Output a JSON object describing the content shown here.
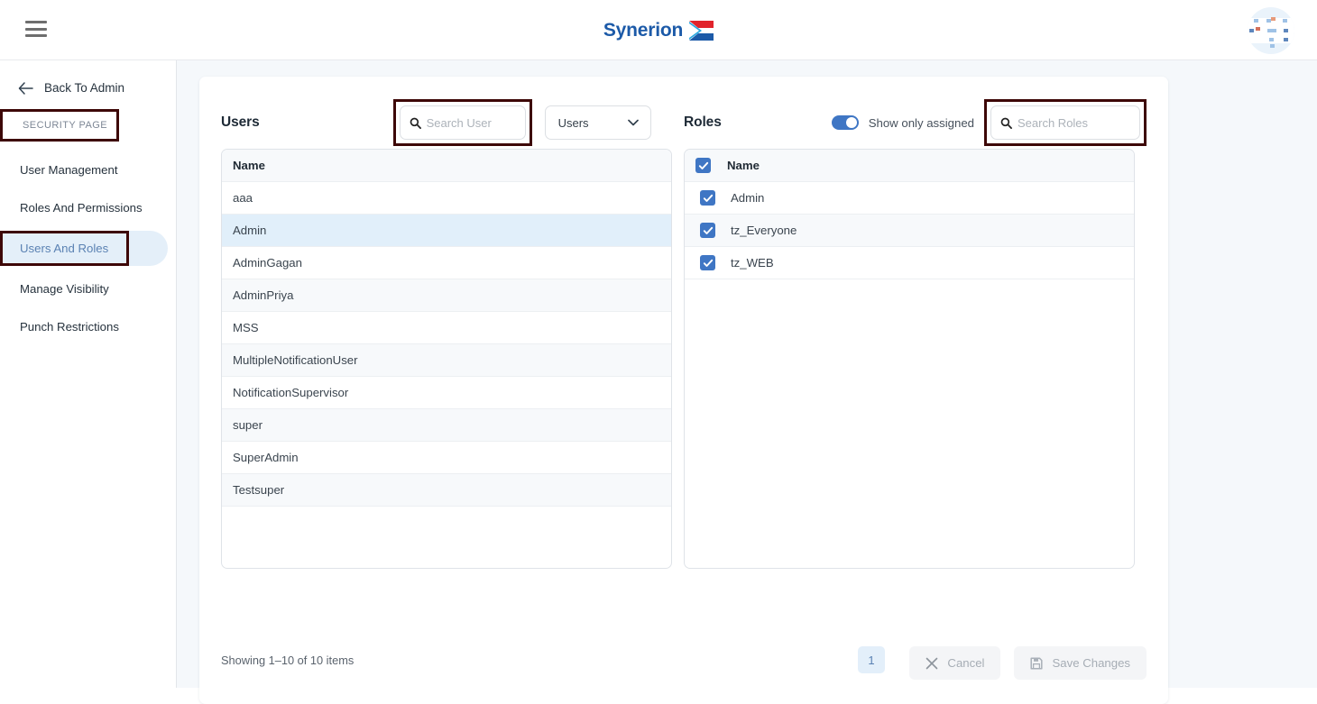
{
  "topbar": {
    "menu_icon": "hamburger-icon",
    "brand_name": "Synerion",
    "avatar_icon": "user-avatar"
  },
  "sidebar": {
    "back_label": "Back To Admin",
    "back_icon": "arrow-left-icon",
    "section_label": "SECURITY PAGE",
    "items": [
      {
        "label": "User Management",
        "active": false
      },
      {
        "label": "Roles And Permissions",
        "active": false
      },
      {
        "label": "Users And Roles",
        "active": true
      },
      {
        "label": "Manage Visibility",
        "active": false
      },
      {
        "label": "Punch Restrictions",
        "active": false
      }
    ]
  },
  "users_panel": {
    "title": "Users",
    "search": {
      "placeholder": "Search User",
      "value": "",
      "icon": "search-icon"
    },
    "filter_select": {
      "value": "Users",
      "icon": "chevron-down-icon"
    },
    "column_header": "Name",
    "rows": [
      {
        "name": "aaa",
        "selected": false
      },
      {
        "name": "Admin",
        "selected": true
      },
      {
        "name": "AdminGagan",
        "selected": false
      },
      {
        "name": "AdminPriya",
        "selected": false
      },
      {
        "name": "MSS",
        "selected": false
      },
      {
        "name": "MultipleNotificationUser",
        "selected": false
      },
      {
        "name": "NotificationSupervisor",
        "selected": false
      },
      {
        "name": "super",
        "selected": false
      },
      {
        "name": "SuperAdmin",
        "selected": false
      },
      {
        "name": "Testsuper",
        "selected": false
      }
    ]
  },
  "roles_panel": {
    "title": "Roles",
    "toggle": {
      "label": "Show only assigned",
      "on": true
    },
    "search": {
      "placeholder": "Search Roles",
      "value": "",
      "icon": "search-icon"
    },
    "column_header": "Name",
    "header_checked": true,
    "rows": [
      {
        "name": "Admin",
        "checked": true
      },
      {
        "name": "tz_Everyone",
        "checked": true
      },
      {
        "name": "tz_WEB",
        "checked": true
      }
    ]
  },
  "footer": {
    "showing_text": "Showing 1–10 of 10 items",
    "page_number": "1",
    "cancel_label": "Cancel",
    "cancel_icon": "close-x-icon",
    "save_label": "Save Changes",
    "save_icon": "save-disk-icon"
  },
  "colors": {
    "accent_blue": "#3f76c4",
    "brand_blue": "#1c5aa8",
    "brand_red": "#e1232b",
    "highlight_box": "#3d0707",
    "selected_row": "#e1effa",
    "page_bg": "#f5f8fb"
  }
}
